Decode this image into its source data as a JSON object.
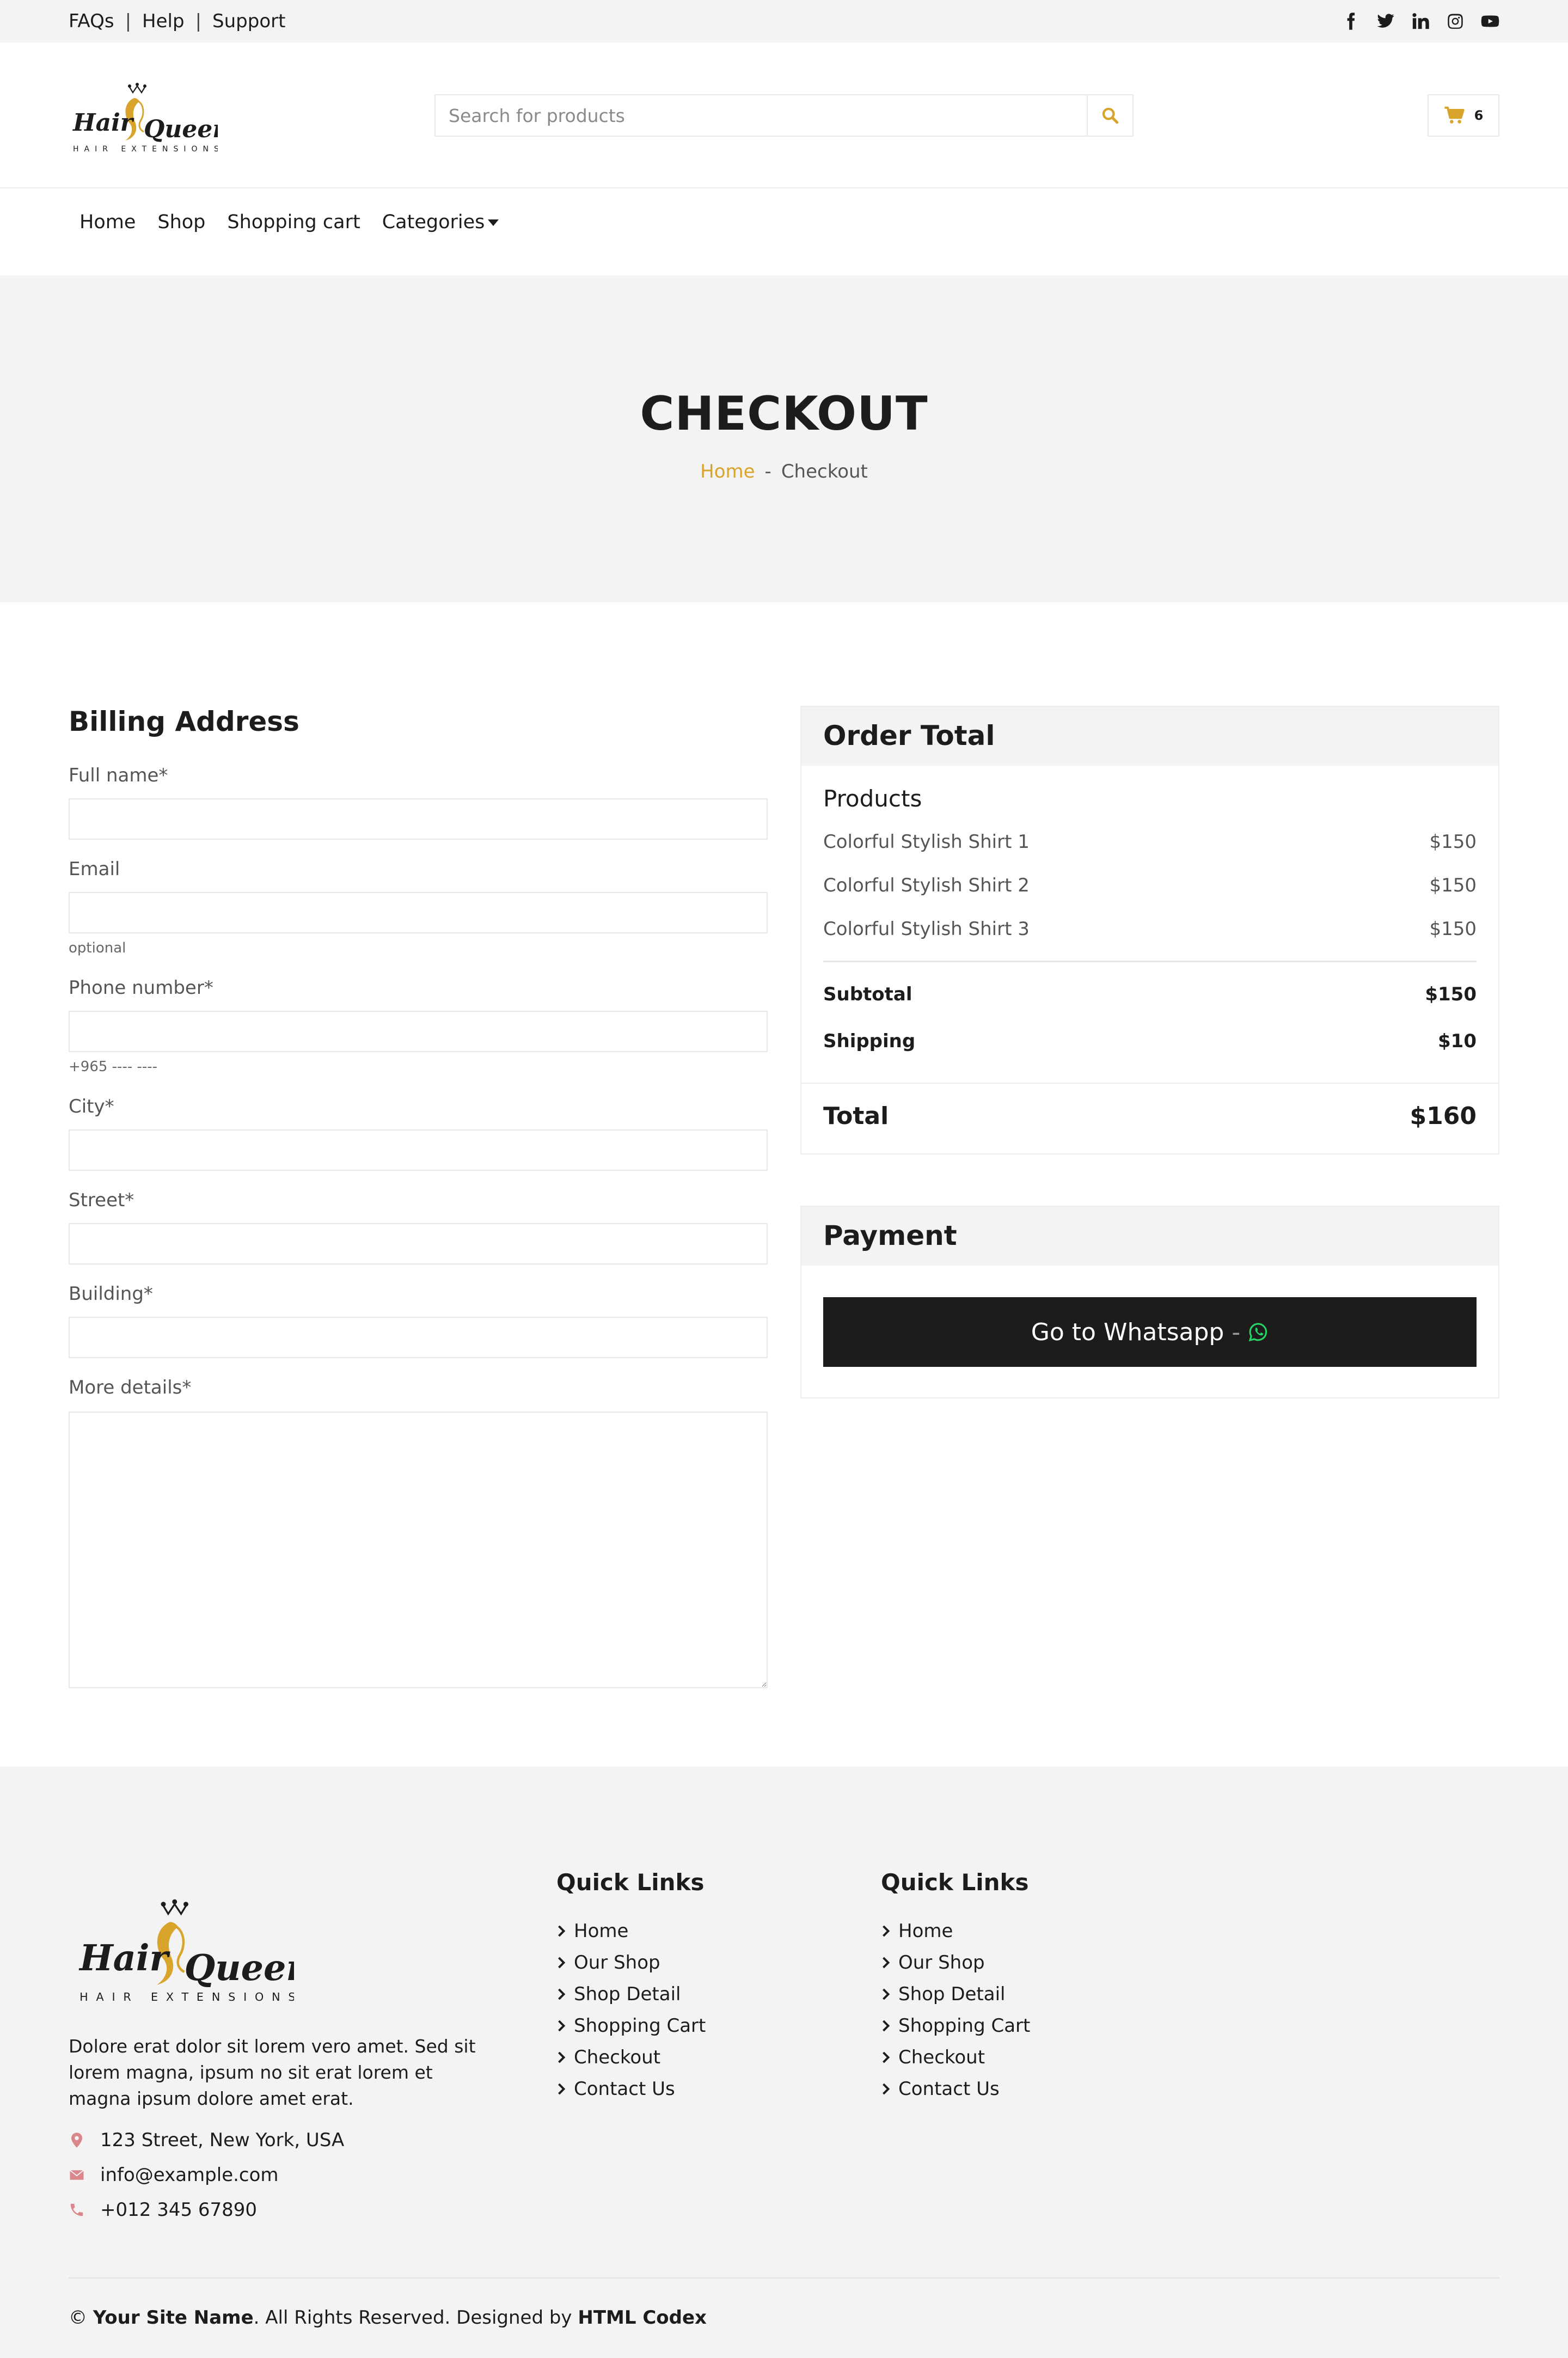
{
  "topbar": {
    "links": [
      "FAQs",
      "Help",
      "Support"
    ],
    "separator": "|",
    "social_icons": [
      "facebook-icon",
      "twitter-icon",
      "linkedin-icon",
      "instagram-icon",
      "youtube-icon"
    ]
  },
  "header": {
    "logo_alt": "Hair Queen Hair Extensions",
    "search_placeholder": "Search for products",
    "cart_count": "6"
  },
  "nav": {
    "items": [
      "Home",
      "Shop",
      "Shopping cart",
      "Categories"
    ]
  },
  "page_header": {
    "title": "CHECKOUT",
    "breadcrumb_home": "Home",
    "breadcrumb_sep": "-",
    "breadcrumb_current": "Checkout"
  },
  "billing": {
    "title": "Billing Address",
    "full_name_label": "Full name*",
    "email_label": "Email",
    "email_hint": "optional",
    "phone_label": "Phone number*",
    "phone_hint": "+965 ---- ----",
    "city_label": "City*",
    "street_label": "Street*",
    "building_label": "Building*",
    "details_label": "More details*"
  },
  "order": {
    "title": "Order Total",
    "products_title": "Products",
    "products": [
      {
        "name": "Colorful Stylish Shirt 1",
        "price": "$150"
      },
      {
        "name": "Colorful Stylish Shirt 2",
        "price": "$150"
      },
      {
        "name": "Colorful Stylish Shirt 3",
        "price": "$150"
      }
    ],
    "subtotal_label": "Subtotal",
    "subtotal_value": "$150",
    "shipping_label": "Shipping",
    "shipping_value": "$10",
    "total_label": "Total",
    "total_value": "$160"
  },
  "payment": {
    "title": "Payment",
    "button_label": "Go to Whatsapp",
    "button_sep": "-"
  },
  "footer": {
    "description": "Dolore erat dolor sit lorem vero amet. Sed sit lorem magna, ipsum no sit erat lorem et magna ipsum dolore amet erat.",
    "address": "123 Street, New York, USA",
    "email": "info@example.com",
    "phone": "+012 345 67890",
    "col1_title": "Quick Links",
    "col2_title": "Quick Links",
    "links": [
      "Home",
      "Our Shop",
      "Shop Detail",
      "Shopping Cart",
      "Checkout",
      "Contact Us"
    ],
    "copyright_symbol": "©",
    "site_name": "Your Site Name",
    "rights_text": ". All Rights Reserved. Designed by ",
    "designer": "HTML Codex"
  },
  "colors": {
    "accent_gold": "#d9a42b",
    "dark": "#1c1c1c",
    "light_bg": "#f3f3f3",
    "contact_icon": "#d9878a",
    "whatsapp_green": "#25d366"
  }
}
